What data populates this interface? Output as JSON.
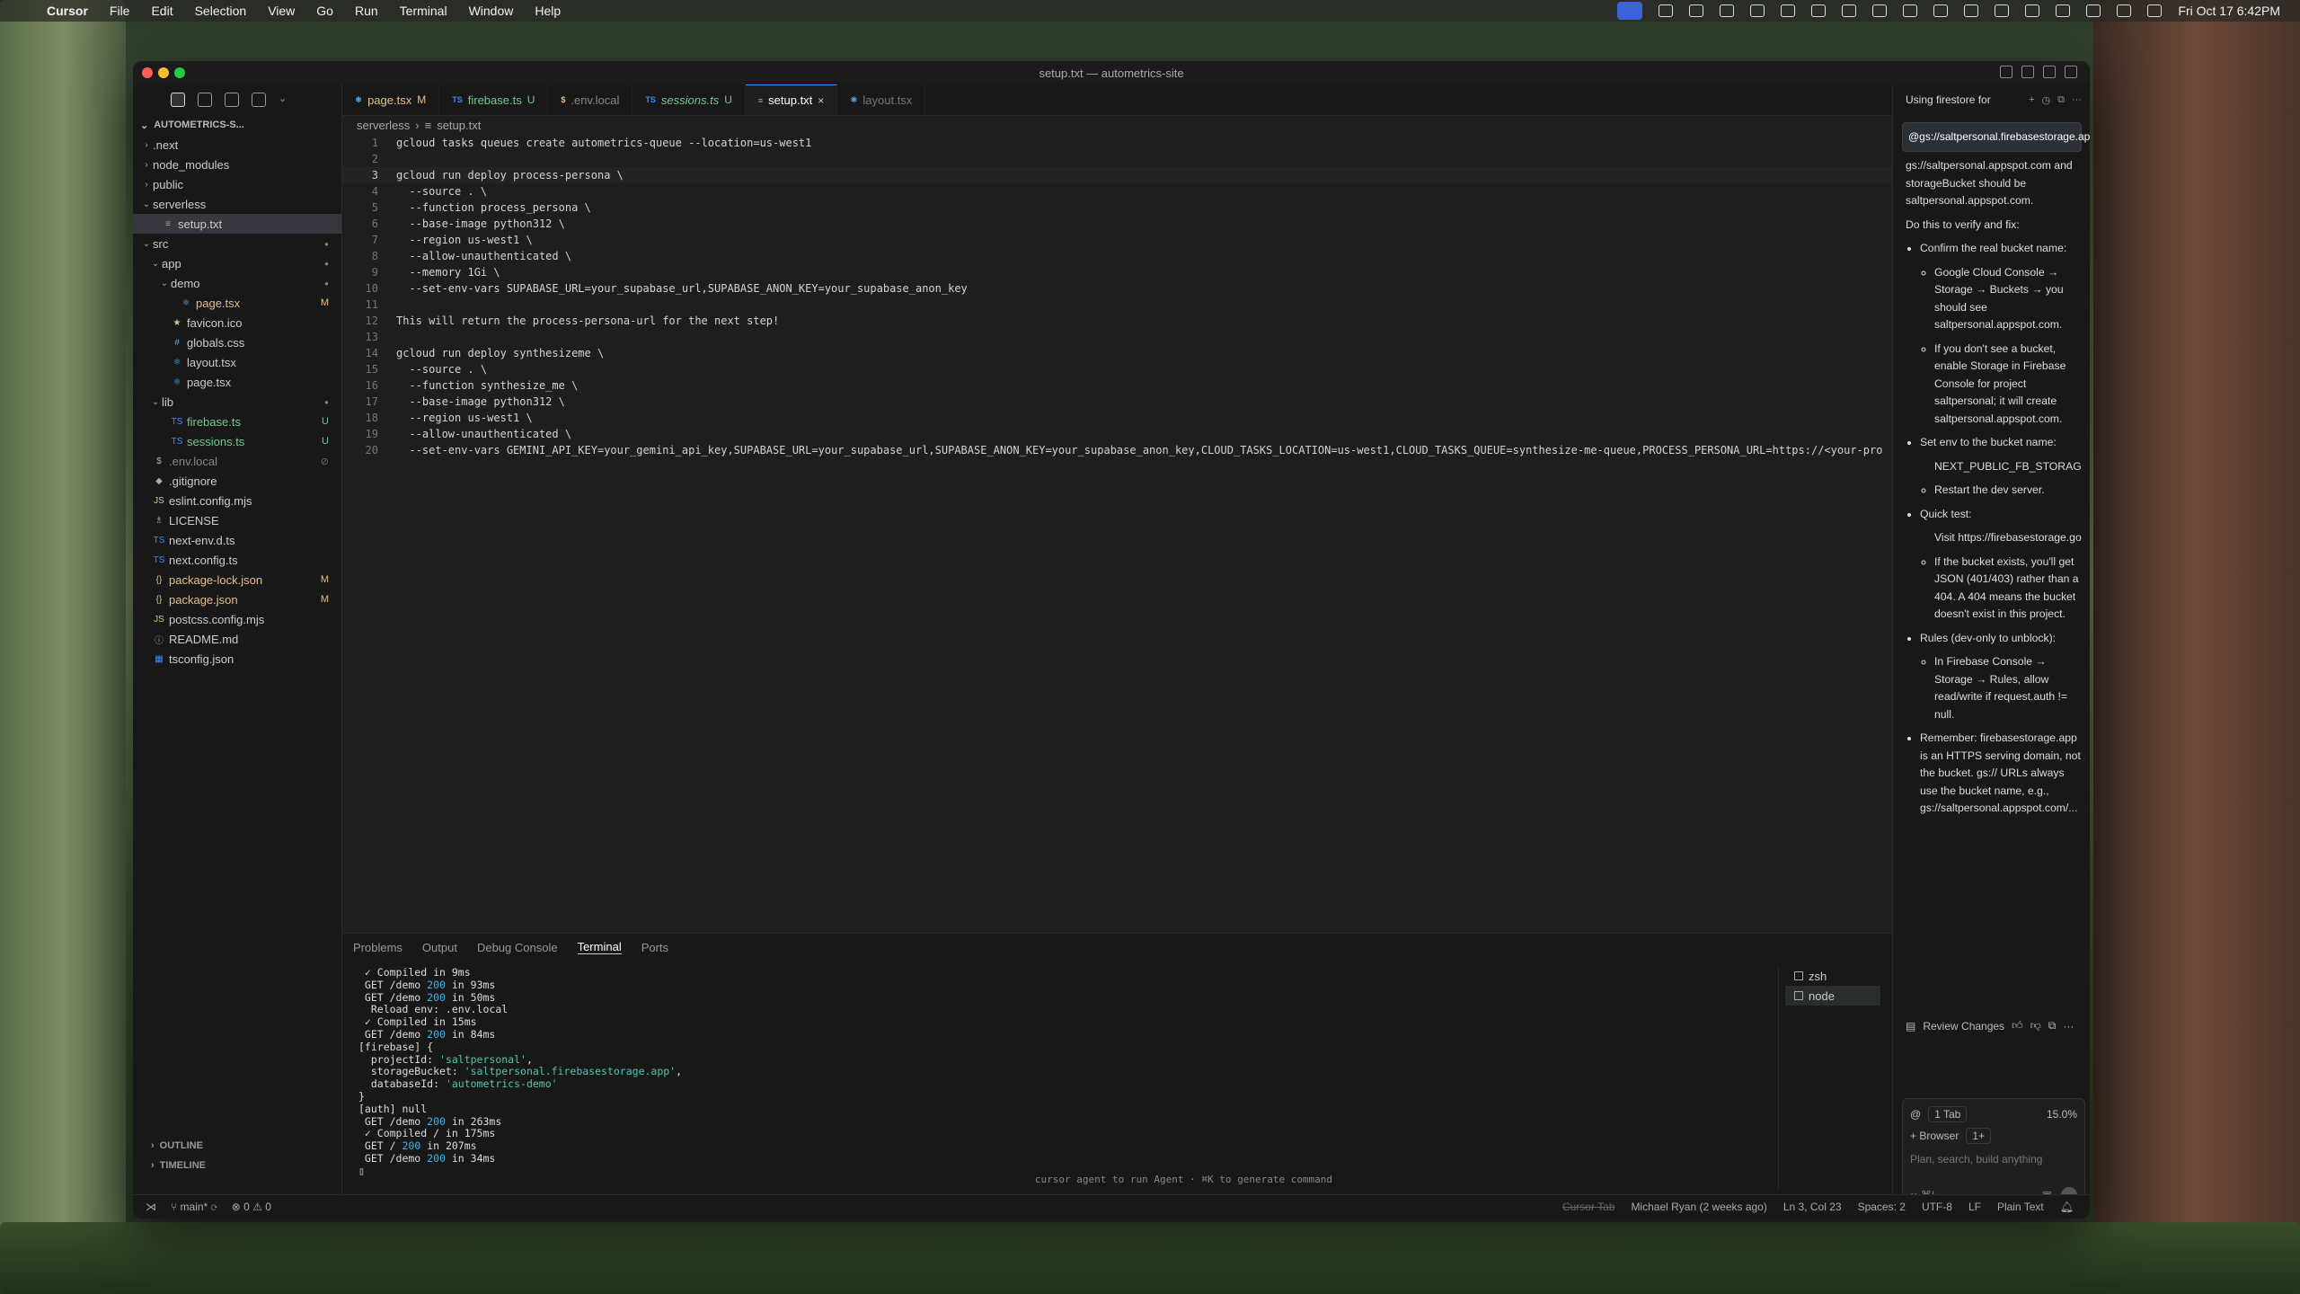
{
  "menubar": {
    "app": "Cursor",
    "menus": [
      "File",
      "Edit",
      "Selection",
      "View",
      "Go",
      "Run",
      "Terminal",
      "Window",
      "Help"
    ],
    "clock": "Fri Oct 17  6:42PM"
  },
  "window": {
    "title": "setup.txt — autometrics-site"
  },
  "explorer": {
    "project": "AUTOMETRICS-S...",
    "items": [
      {
        "label": ".next",
        "type": "folder",
        "depth": 0,
        "open": false,
        "status": ""
      },
      {
        "label": "node_modules",
        "type": "folder",
        "depth": 0,
        "open": false,
        "status": ""
      },
      {
        "label": "public",
        "type": "folder",
        "depth": 0,
        "open": false,
        "status": ""
      },
      {
        "label": "serverless",
        "type": "folder",
        "depth": 0,
        "open": true,
        "status": ""
      },
      {
        "label": "setup.txt",
        "type": "file",
        "icon": "≡",
        "depth": 1,
        "status": "",
        "selected": true
      },
      {
        "label": "src",
        "type": "folder",
        "depth": 0,
        "open": true,
        "status": "dot"
      },
      {
        "label": "app",
        "type": "folder",
        "depth": 1,
        "open": true,
        "status": "dot"
      },
      {
        "label": "demo",
        "type": "folder",
        "depth": 2,
        "open": true,
        "status": "dot"
      },
      {
        "label": "page.tsx",
        "type": "file",
        "icon": "⚛",
        "depth": 3,
        "status": "M"
      },
      {
        "label": "favicon.ico",
        "type": "file",
        "icon": "★",
        "depth": 2,
        "status": ""
      },
      {
        "label": "globals.css",
        "type": "file",
        "icon": "#",
        "depth": 2,
        "status": ""
      },
      {
        "label": "layout.tsx",
        "type": "file",
        "icon": "⚛",
        "depth": 2,
        "status": ""
      },
      {
        "label": "page.tsx",
        "type": "file",
        "icon": "⚛",
        "depth": 2,
        "status": ""
      },
      {
        "label": "lib",
        "type": "folder",
        "depth": 1,
        "open": true,
        "status": "dot"
      },
      {
        "label": "firebase.ts",
        "type": "file",
        "icon": "TS",
        "depth": 2,
        "status": "U"
      },
      {
        "label": "sessions.ts",
        "type": "file",
        "icon": "TS",
        "depth": 2,
        "status": "U"
      },
      {
        "label": ".env.local",
        "type": "file",
        "icon": "$",
        "depth": 0,
        "status": "ignored"
      },
      {
        "label": ".gitignore",
        "type": "file",
        "icon": "◆",
        "depth": 0,
        "status": ""
      },
      {
        "label": "eslint.config.mjs",
        "type": "file",
        "icon": "JS",
        "depth": 0,
        "status": ""
      },
      {
        "label": "LICENSE",
        "type": "file",
        "icon": "♗",
        "depth": 0,
        "status": ""
      },
      {
        "label": "next-env.d.ts",
        "type": "file",
        "icon": "TS",
        "depth": 0,
        "status": ""
      },
      {
        "label": "next.config.ts",
        "type": "file",
        "icon": "TS",
        "depth": 0,
        "status": ""
      },
      {
        "label": "package-lock.json",
        "type": "file",
        "icon": "{}",
        "depth": 0,
        "status": "M"
      },
      {
        "label": "package.json",
        "type": "file",
        "icon": "{}",
        "depth": 0,
        "status": "M"
      },
      {
        "label": "postcss.config.mjs",
        "type": "file",
        "icon": "JS",
        "depth": 0,
        "status": ""
      },
      {
        "label": "README.md",
        "type": "file",
        "icon": "ⓘ",
        "depth": 0,
        "status": ""
      },
      {
        "label": "tsconfig.json",
        "type": "file",
        "icon": "▦",
        "depth": 0,
        "status": ""
      }
    ],
    "outline": "OUTLINE",
    "timeline": "TIMELINE"
  },
  "tabs": [
    {
      "label": "page.tsx",
      "icon": "⚛",
      "status": "M",
      "active": false,
      "italic": false,
      "color": "#e2c08d"
    },
    {
      "label": "firebase.ts",
      "icon": "TS",
      "status": "U",
      "active": false,
      "italic": false,
      "color": "#73c991"
    },
    {
      "label": ".env.local",
      "icon": "$",
      "status": "",
      "active": false,
      "italic": false,
      "color": "#888888"
    },
    {
      "label": "sessions.ts",
      "icon": "TS",
      "status": "U",
      "active": false,
      "italic": true,
      "color": "#73c991"
    },
    {
      "label": "setup.txt",
      "icon": "≡",
      "status": "×",
      "active": true,
      "italic": false,
      "color": "#ffffff"
    },
    {
      "label": "layout.tsx",
      "icon": "⚛",
      "status": "",
      "active": false,
      "italic": false,
      "color": "#777777"
    }
  ],
  "breadcrumb": {
    "folder": "serverless",
    "file": "setup.txt"
  },
  "code_lines": [
    "gcloud tasks queues create autometrics-queue --location=us-west1",
    "",
    "gcloud run deploy process-persona \\",
    "  --source . \\",
    "  --function process_persona \\",
    "  --base-image python312 \\",
    "  --region us-west1 \\",
    "  --allow-unauthenticated \\",
    "  --memory 1Gi \\",
    "  --set-env-vars SUPABASE_URL=your_supabase_url,SUPABASE_ANON_KEY=your_supabase_anon_key",
    "",
    "This will return the process-persona-url for the next step!",
    "",
    "gcloud run deploy synthesizeme \\",
    "  --source . \\",
    "  --function synthesize_me \\",
    "  --base-image python312 \\",
    "  --region us-west1 \\",
    "  --allow-unauthenticated \\",
    "  --set-env-vars GEMINI_API_KEY=your_gemini_api_key,SUPABASE_URL=your_supabase_url,SUPABASE_ANON_KEY=your_supabase_anon_key,CLOUD_TASKS_LOCATION=us-west1,CLOUD_TASKS_QUEUE=synthesize-me-queue,PROCESS_PERSONA_URL=https://<your-pro"
  ],
  "current_line": 3,
  "panel": {
    "tabs": [
      "Problems",
      "Output",
      "Debug Console",
      "Terminal",
      "Ports"
    ],
    "active_tab": "Terminal",
    "terminal_lines": [
      [
        {
          "t": " ✓ Compiled in 9ms",
          "c": ""
        }
      ],
      [
        {
          "t": " GET /demo ",
          "c": ""
        },
        {
          "t": "200",
          "c": "num"
        },
        {
          "t": " in 93ms",
          "c": ""
        }
      ],
      [
        {
          "t": " GET /demo ",
          "c": ""
        },
        {
          "t": "200",
          "c": "num"
        },
        {
          "t": " in 50ms",
          "c": ""
        }
      ],
      [
        {
          "t": "  Reload env: .env.local",
          "c": ""
        }
      ],
      [
        {
          "t": " ✓ Compiled in 15ms",
          "c": ""
        }
      ],
      [
        {
          "t": " GET /demo ",
          "c": ""
        },
        {
          "t": "200",
          "c": "num"
        },
        {
          "t": " in 84ms",
          "c": ""
        }
      ],
      [
        {
          "t": "[firebase] {",
          "c": ""
        }
      ],
      [
        {
          "t": "  projectId: ",
          "c": ""
        },
        {
          "t": "'saltpersonal'",
          "c": "str"
        },
        {
          "t": ",",
          "c": ""
        }
      ],
      [
        {
          "t": "  storageBucket: ",
          "c": ""
        },
        {
          "t": "'saltpersonal.firebasestorage.app'",
          "c": "str"
        },
        {
          "t": ",",
          "c": ""
        }
      ],
      [
        {
          "t": "  databaseId: ",
          "c": ""
        },
        {
          "t": "'autometrics-demo'",
          "c": "str"
        }
      ],
      [
        {
          "t": "}",
          "c": ""
        }
      ],
      [
        {
          "t": "[auth] null",
          "c": ""
        }
      ],
      [
        {
          "t": " GET /demo ",
          "c": ""
        },
        {
          "t": "200",
          "c": "num"
        },
        {
          "t": " in 263ms",
          "c": ""
        }
      ],
      [
        {
          "t": " ✓ Compiled / in 175ms",
          "c": ""
        }
      ],
      [
        {
          "t": " GET / ",
          "c": ""
        },
        {
          "t": "200",
          "c": "num"
        },
        {
          "t": " in 207ms",
          "c": ""
        }
      ],
      [
        {
          "t": " GET /demo ",
          "c": ""
        },
        {
          "t": "200",
          "c": "num"
        },
        {
          "t": " in 34ms",
          "c": ""
        }
      ],
      [
        {
          "t": "▯",
          "c": ""
        }
      ]
    ],
    "terminals": [
      "zsh",
      "node"
    ],
    "active_terminal": "node",
    "hint": "cursor agent to run Agent · ⌘K to generate command"
  },
  "chat": {
    "title": "Using firestore for",
    "mention": "@gs://saltpersonal.firebasestorage.app",
    "intro": "gs://saltpersonal.appspot.com and storageBucket should be saltpersonal.appspot.com.",
    "do_this": "Do this to verify and fix:",
    "steps": [
      {
        "text": "Confirm the real bucket name:",
        "sub": [
          "Google Cloud Console → Storage → Buckets → you should see saltpersonal.appspot.com.",
          "If you don't see a bucket, enable Storage in Firebase Console for project saltpersonal; it will create saltpersonal.appspot.com."
        ]
      },
      {
        "text": "Set env to the bucket name:",
        "sub": [
          "NEXT_PUBLIC_FB_STORAGE_BUCKET",
          "Restart the dev server."
        ]
      },
      {
        "text": "Quick test:",
        "sub": [
          "Visit https://firebasestorage.googleapis.com",
          "If the bucket exists, you'll get JSON (401/403) rather than a 404. A 404 means the bucket doesn't exist in this project."
        ]
      },
      {
        "text": "Rules (dev-only to unblock):",
        "sub": [
          "In Firebase Console → Storage → Rules, allow read/write if request.auth != null."
        ]
      },
      {
        "text": "Remember: firebasestorage.app is an HTTPS serving domain, not the bucket. gs:// URLs always use the bucket name, e.g., gs://saltpersonal.appspot.com/...",
        "sub": []
      }
    ],
    "review": "Review Changes",
    "composer": {
      "tab_chip": "1 Tab",
      "percent": "15.0%",
      "browser": "Browser",
      "browser_badge": "1+",
      "placeholder": "Plan, search, build anything",
      "mode": "∞ ⌘I ⌄"
    }
  },
  "statusbar": {
    "branch": "main*",
    "problems": "⊗ 0 ⚠ 0",
    "cursor_tab": "Cursor Tab",
    "blame": "Michael Ryan (2 weeks ago)",
    "position": "Ln 3, Col 23",
    "spaces": "Spaces: 2",
    "encoding": "UTF-8",
    "eol": "LF",
    "language": "Plain Text"
  }
}
